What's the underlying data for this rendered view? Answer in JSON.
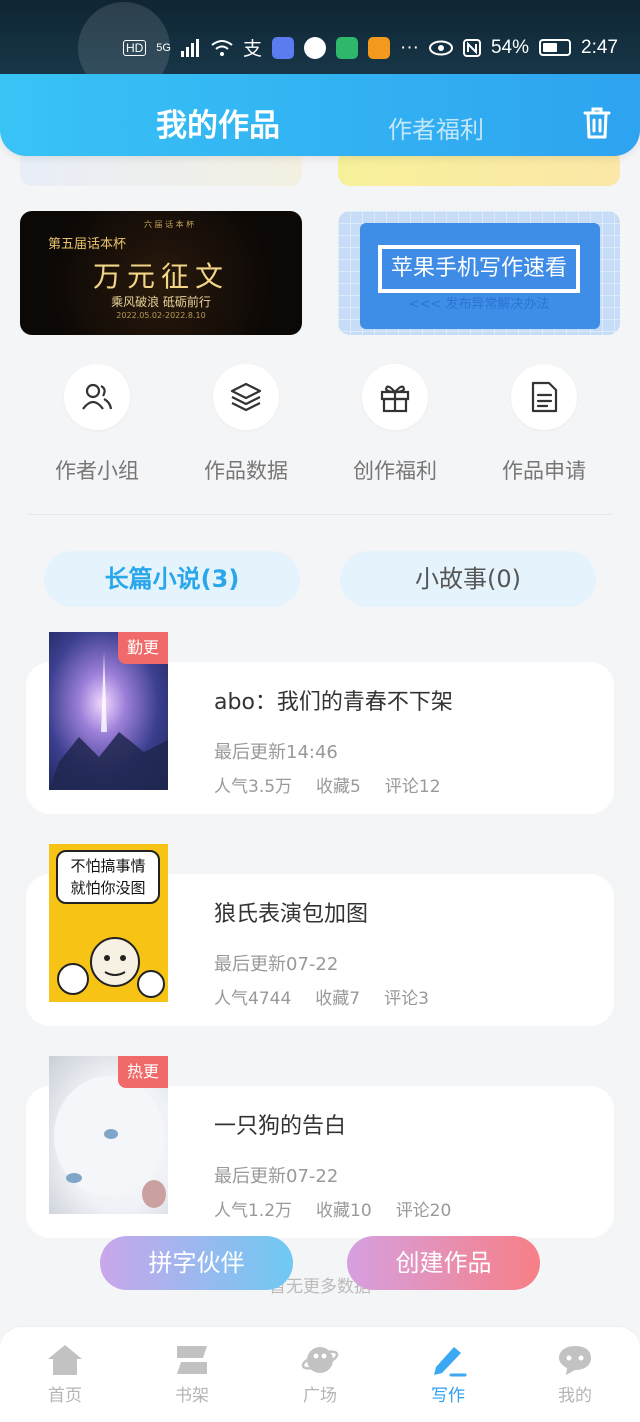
{
  "status_bar": {
    "signal_label": "HD",
    "network_label": "5G",
    "battery": "54%",
    "time": "2:47",
    "more": "···"
  },
  "header": {
    "tab_works": "我的作品",
    "tab_welfare": "作者福利"
  },
  "banners": {
    "contest": {
      "tiny": "六 届 话 本 杯",
      "sub": "第五届话本杯",
      "title": "万元征文",
      "slogan": "乘风破浪 砥砺前行",
      "date": "2022.05.02-2022.8.10"
    },
    "iphone": {
      "title": "苹果手机写作速看",
      "sub": "<<< 发布异常解决办法"
    }
  },
  "quick_entries": [
    {
      "label": "作者小组",
      "icon": "people-icon"
    },
    {
      "label": "作品数据",
      "icon": "layers-icon"
    },
    {
      "label": "创作福利",
      "icon": "gift-icon"
    },
    {
      "label": "作品申请",
      "icon": "document-icon"
    }
  ],
  "tabs": {
    "novel": "长篇小说(3)",
    "story": "小故事(0)"
  },
  "works": [
    {
      "title": "abo：我们的青春不下架",
      "update": "最后更新14:46",
      "popularity": "人气3.5万",
      "favorites": "收藏5",
      "comments": "评论12",
      "badge": "勤更"
    },
    {
      "title": "狼氏表演包加图",
      "update": "最后更新07-22",
      "popularity": "人气4744",
      "favorites": "收藏7",
      "comments": "评论3",
      "badge": "",
      "cover_text": "不怕搞事情\n就怕你没图"
    },
    {
      "title": "一只狗的告白",
      "update": "最后更新07-22",
      "popularity": "人气1.2万",
      "favorites": "收藏10",
      "comments": "评论20",
      "badge": "热更"
    }
  ],
  "more_text": "暂无更多数据",
  "fab": {
    "partner": "拼字伙伴",
    "create": "创建作品"
  },
  "nav": [
    {
      "label": "首页",
      "icon": "home-icon"
    },
    {
      "label": "书架",
      "icon": "bookshelf-icon"
    },
    {
      "label": "广场",
      "icon": "planet-icon"
    },
    {
      "label": "写作",
      "icon": "pen-icon"
    },
    {
      "label": "我的",
      "icon": "chat-icon"
    }
  ],
  "colors": {
    "accent": "#2ea3f0",
    "badge": "#f06a6a"
  }
}
